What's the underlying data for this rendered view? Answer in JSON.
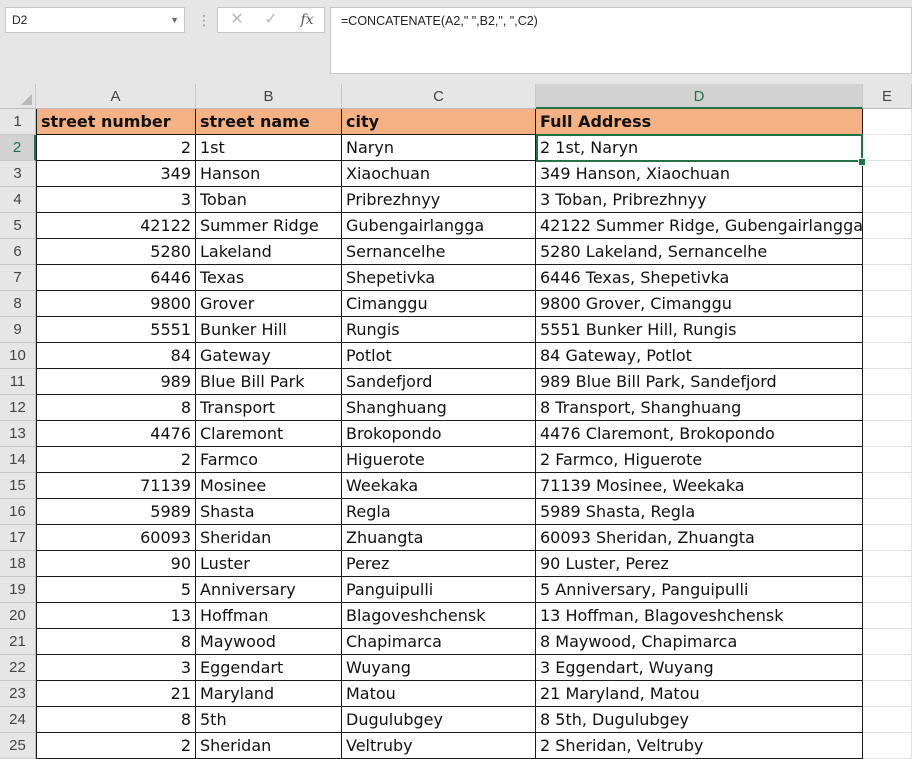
{
  "name_box": {
    "value": "D2"
  },
  "formula_bar": {
    "formula": "=CONCATENATE(A2,\" \",B2,\", \",C2)",
    "cancel_icon": "✕",
    "enter_icon": "✓",
    "function_icon": "fx"
  },
  "columns": [
    "A",
    "B",
    "C",
    "D",
    "E"
  ],
  "active_column": "D",
  "active_row": 2,
  "headers": [
    "street number",
    "street name",
    "city",
    "Full Address"
  ],
  "rows": [
    {
      "row": "2",
      "number": "2",
      "street": "1st",
      "city": "Naryn",
      "full": "2 1st, Naryn"
    },
    {
      "row": "3",
      "number": "349",
      "street": "Hanson",
      "city": "Xiaochuan",
      "full": "349 Hanson, Xiaochuan"
    },
    {
      "row": "4",
      "number": "3",
      "street": "Toban",
      "city": "Pribrezhnyy",
      "full": "3 Toban, Pribrezhnyy"
    },
    {
      "row": "5",
      "number": "42122",
      "street": "Summer Ridge",
      "city": "Gubengairlangga",
      "full": "42122 Summer Ridge, Gubengairlangga"
    },
    {
      "row": "6",
      "number": "5280",
      "street": "Lakeland",
      "city": "Sernancelhe",
      "full": "5280 Lakeland, Sernancelhe"
    },
    {
      "row": "7",
      "number": "6446",
      "street": "Texas",
      "city": "Shepetivka",
      "full": "6446 Texas, Shepetivka"
    },
    {
      "row": "8",
      "number": "9800",
      "street": "Grover",
      "city": "Cimanggu",
      "full": "9800 Grover, Cimanggu"
    },
    {
      "row": "9",
      "number": "5551",
      "street": "Bunker Hill",
      "city": "Rungis",
      "full": "5551 Bunker Hill, Rungis"
    },
    {
      "row": "10",
      "number": "84",
      "street": "Gateway",
      "city": "Potlot",
      "full": "84 Gateway, Potlot"
    },
    {
      "row": "11",
      "number": "989",
      "street": "Blue Bill Park",
      "city": "Sandefjord",
      "full": "989 Blue Bill Park, Sandefjord"
    },
    {
      "row": "12",
      "number": "8",
      "street": "Transport",
      "city": "Shanghuang",
      "full": "8 Transport, Shanghuang"
    },
    {
      "row": "13",
      "number": "4476",
      "street": "Claremont",
      "city": "Brokopondo",
      "full": "4476 Claremont, Brokopondo"
    },
    {
      "row": "14",
      "number": "2",
      "street": "Farmco",
      "city": "Higuerote",
      "full": "2 Farmco, Higuerote"
    },
    {
      "row": "15",
      "number": "71139",
      "street": "Mosinee",
      "city": "Weekaka",
      "full": "71139 Mosinee, Weekaka"
    },
    {
      "row": "16",
      "number": "5989",
      "street": "Shasta",
      "city": "Regla",
      "full": "5989 Shasta, Regla"
    },
    {
      "row": "17",
      "number": "60093",
      "street": "Sheridan",
      "city": "Zhuangta",
      "full": "60093 Sheridan, Zhuangta"
    },
    {
      "row": "18",
      "number": "90",
      "street": "Luster",
      "city": "Perez",
      "full": "90 Luster, Perez"
    },
    {
      "row": "19",
      "number": "5",
      "street": "Anniversary",
      "city": "Panguipulli",
      "full": "5 Anniversary, Panguipulli"
    },
    {
      "row": "20",
      "number": "13",
      "street": "Hoffman",
      "city": "Blagoveshchensk",
      "full": "13 Hoffman, Blagoveshchensk"
    },
    {
      "row": "21",
      "number": "8",
      "street": "Maywood",
      "city": "Chapimarca",
      "full": "8 Maywood, Chapimarca"
    },
    {
      "row": "22",
      "number": "3",
      "street": "Eggendart",
      "city": "Wuyang",
      "full": "3 Eggendart, Wuyang"
    },
    {
      "row": "23",
      "number": "21",
      "street": "Maryland",
      "city": "Matou",
      "full": "21 Maryland, Matou"
    },
    {
      "row": "24",
      "number": "8",
      "street": "5th",
      "city": "Dugulubgey",
      "full": "8 5th, Dugulubgey"
    },
    {
      "row": "25",
      "number": "2",
      "street": "Sheridan",
      "city": "Veltruby",
      "full": "2 Sheridan, Veltruby"
    }
  ],
  "colors": {
    "header_fill": "#f4b183",
    "selection": "#217346",
    "chrome": "#e6e6e6"
  }
}
